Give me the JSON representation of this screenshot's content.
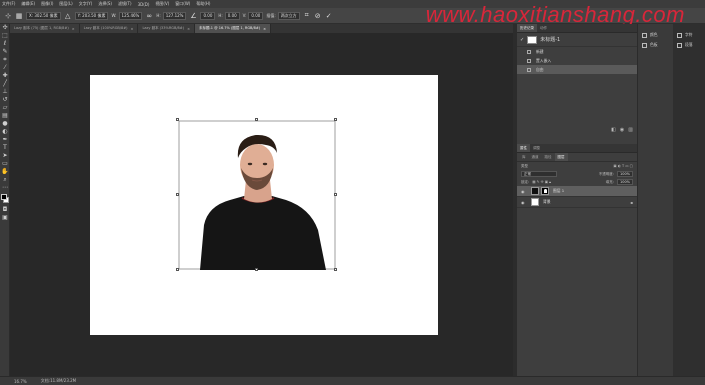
{
  "menu": [
    "文件(F)",
    "编辑(E)",
    "图像(I)",
    "图层(L)",
    "文字(Y)",
    "选择(S)",
    "滤镜(T)",
    "3D(D)",
    "视图(V)",
    "窗口(W)",
    "帮助(H)"
  ],
  "options": {
    "x": "X: 302.50 像素",
    "y": "Y: 203.50 像素",
    "w_label": "W:",
    "w": "125.46%",
    "h_label": "H:",
    "h": "127.12%",
    "angle": "0.00",
    "hskew": "0.00",
    "vskew": "0.00",
    "interp_label": "插值:",
    "interp": "两次立方"
  },
  "watermark": "www.haoxitianshang.com",
  "doc_tabs": [
    {
      "label": "Lazy 副本 (75) (图层 1, RGB/8#)"
    },
    {
      "label": "Lazy 副本 (100%RGB/8#)"
    },
    {
      "label": "Lazy 副本 (33%RGB/8#)"
    },
    {
      "label": "未标题-1 @ 16.7% (图层 1, RGB/8#)",
      "active": true
    }
  ],
  "history": {
    "tabs": [
      "历史记录",
      "动作"
    ],
    "snapshot": "未标题-1",
    "items": [
      {
        "label": "新建"
      },
      {
        "label": "置入嵌入"
      },
      {
        "label": "自由",
        "active": true
      }
    ]
  },
  "layers": {
    "top_tabs": [
      "属性",
      "调整"
    ],
    "tabs": [
      "库",
      "通道",
      "路径",
      "图层"
    ],
    "kind_label": "类型",
    "mode": "正常",
    "opacity_label": "不透明度:",
    "opacity": "100%",
    "lock_label": "锁定:",
    "fill_label": "填充:",
    "fill": "100%",
    "items": [
      {
        "name": "图层 1",
        "active": true,
        "has_mask": true
      },
      {
        "name": "背景",
        "active": false,
        "locked": true
      }
    ]
  },
  "side_panel": [
    {
      "label": "颜色"
    },
    {
      "label": "色板"
    }
  ],
  "far_panel": [
    {
      "label": "字符"
    },
    {
      "label": "段落"
    }
  ],
  "status": {
    "zoom": "16.7%",
    "doc": "文档:11.8M/23.2M"
  }
}
